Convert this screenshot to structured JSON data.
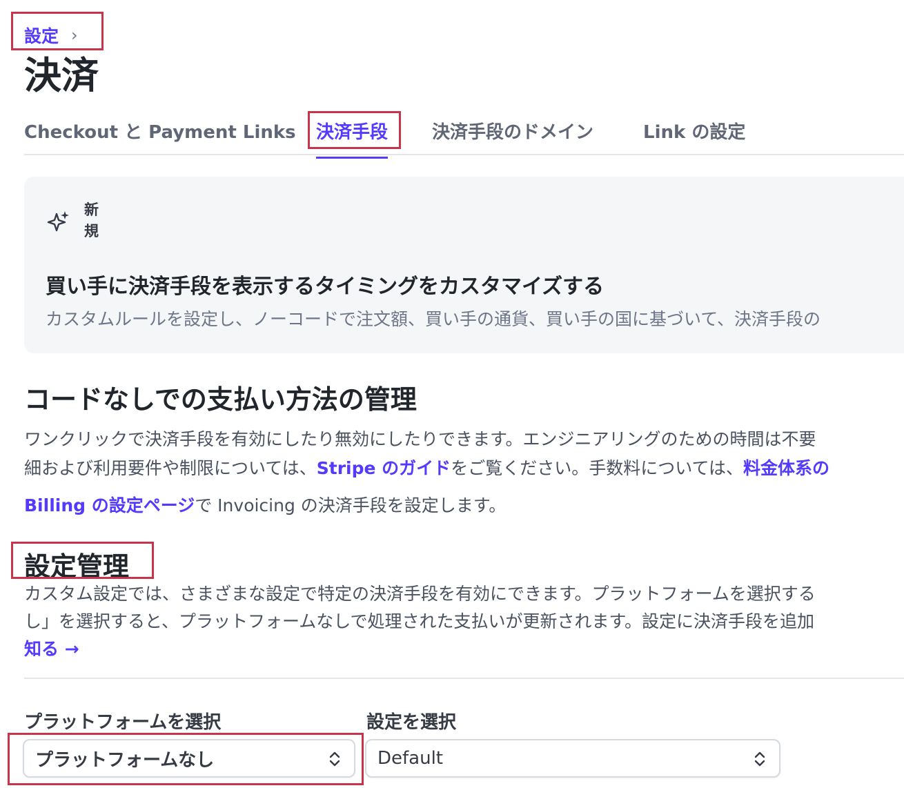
{
  "breadcrumb": {
    "parent": "設定",
    "separator": "›"
  },
  "page_title": "決済",
  "tabs": [
    {
      "label": "Checkout と Payment Links"
    },
    {
      "label": "決済手段"
    },
    {
      "label": "決済手段のドメイン"
    },
    {
      "label": "Link の設定"
    }
  ],
  "promo": {
    "badge": "新規",
    "icon": "sparkle-icon",
    "title": "買い手に決済手段を表示するタイミングをカスタマイズする",
    "text": "カスタムルールを設定し、ノーコードで注文額、買い手の通貨、買い手の国に基づいて、決済手段の"
  },
  "section": {
    "title": "コードなしでの支払い方法の管理",
    "line1": "ワンクリックで決済手段を有効にしたり無効にしたりできます。エンジニアリングのための時間は不要",
    "line2_pre": "細および利用要件や制限については、",
    "line2_link": "Stripe のガイド",
    "line2_mid": "をご覧ください。手数料については、",
    "line2_link2": "料金体系の",
    "billing_link": "Billing の設定ページ",
    "billing_rest": "で Invoicing の決済手段を設定します。"
  },
  "settings": {
    "title": "設定管理",
    "line1": "カスタム設定では、さまざまな設定で特定の決済手段を有効にできます。プラットフォームを選択する",
    "line2": "し」を選択すると、プラットフォームなしで処理された支払いが更新されます。設定に決済手段を追加",
    "learn_more": "知る →"
  },
  "platform_select": {
    "label": "プラットフォームを選択",
    "value": "プラットフォームなし"
  },
  "config_select": {
    "label": "設定を選択",
    "value": "Default"
  },
  "colors": {
    "accent": "#533afd",
    "highlight": "#c8344a"
  }
}
